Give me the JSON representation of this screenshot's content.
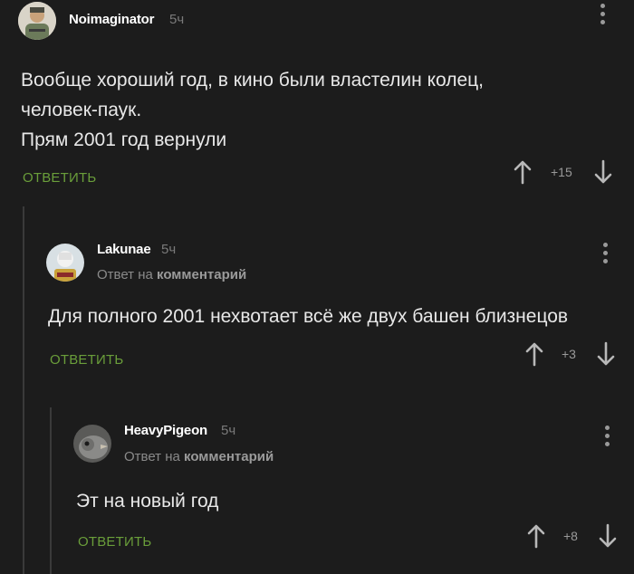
{
  "comments": [
    {
      "author": "Noimaginator",
      "time": "5ч",
      "lines": [
        "Вообще хороший год, в кино были властелин колец,",
        "человек-паук.",
        "Прям 2001 год вернули"
      ],
      "reply_label": "ОТВЕТИТЬ",
      "score": "+15"
    },
    {
      "author": "Lakunae",
      "time": "5ч",
      "reply_prefix": "Ответ на",
      "reply_target": "комментарий",
      "lines": [
        "Для полного 2001 нехвотает всё же двух башен близнецов"
      ],
      "reply_label": "ОТВЕТИТЬ",
      "score": "+3"
    },
    {
      "author": "HeavyPigeon",
      "time": "5ч",
      "reply_prefix": "Ответ на",
      "reply_target": "комментарий",
      "lines": [
        "Эт на новый год"
      ],
      "reply_label": "ОТВЕТИТЬ",
      "score": "+8"
    }
  ],
  "colors": {
    "background": "#1c1c1c",
    "reply_green": "#6a9e3a",
    "thread_line": "#3a3a3a"
  },
  "icons": [
    "menu-dots-icon",
    "upvote-arrow-icon",
    "downvote-arrow-icon"
  ]
}
